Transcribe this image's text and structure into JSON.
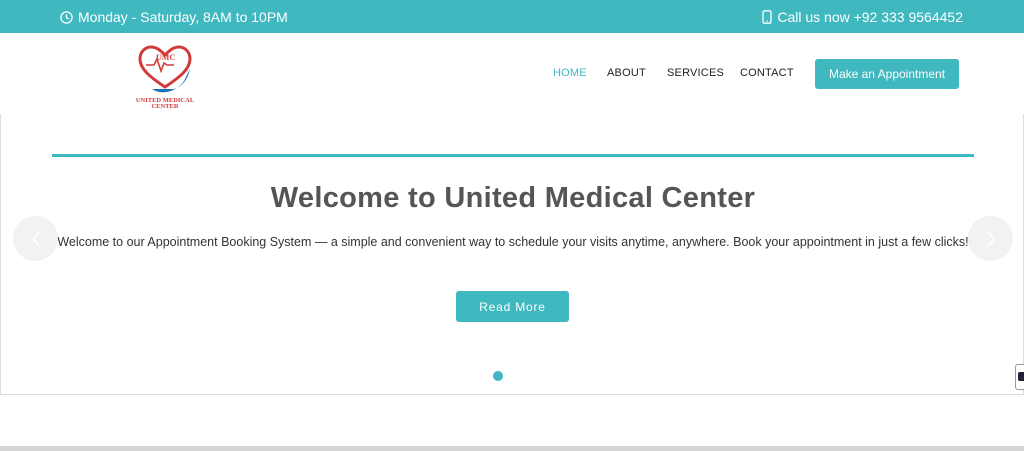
{
  "topbar": {
    "hours": "Monday - Saturday, 8AM to 10PM",
    "phone": "Call us now +92 333 9564452",
    "hours_icon": "clock-icon",
    "phone_icon": "mobile-phone-icon"
  },
  "logo": {
    "mark": "UMC",
    "name_line1": "UNITED MEDICAL",
    "name_line2": "CENTER"
  },
  "nav": {
    "items": [
      {
        "label": "HOME",
        "active": true
      },
      {
        "label": "ABOUT",
        "active": false
      },
      {
        "label": "SERVICES",
        "active": false
      },
      {
        "label": "CONTACT",
        "active": false
      }
    ],
    "cta": "Make an Appointment"
  },
  "hero": {
    "title": "Welcome to United Medical Center",
    "description": "Welcome to our Appointment Booking System — a simple and convenient way to schedule your visits anytime, anywhere. Book your appointment in just a few clicks!",
    "button": "Read More",
    "slide_count": 1,
    "current_slide": 1
  },
  "colors": {
    "accent": "#3fb8bf",
    "logo_red": "#d23a3a",
    "logo_blue": "#1f6fb5",
    "heading": "#555555"
  }
}
